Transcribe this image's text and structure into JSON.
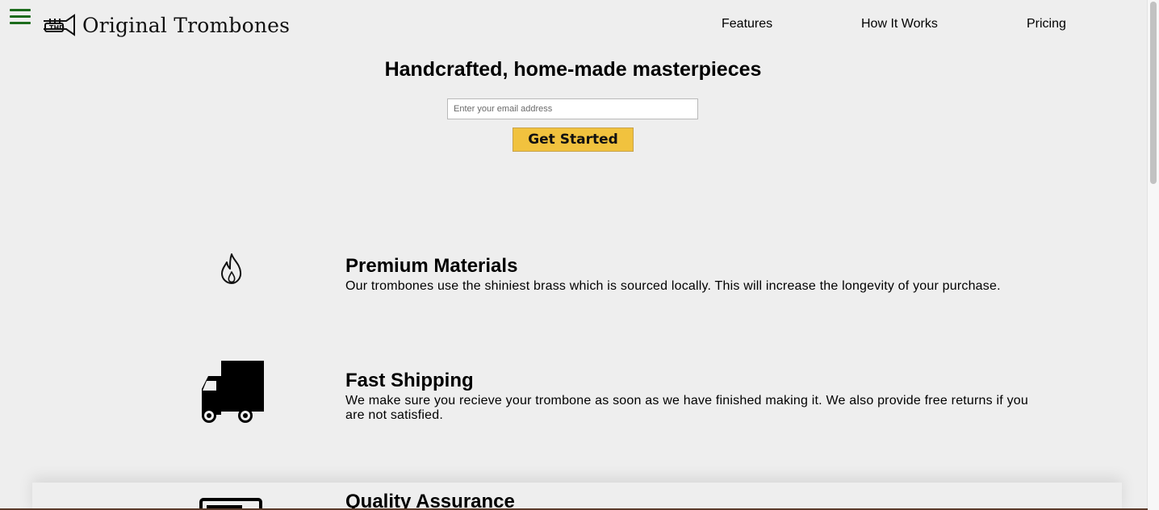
{
  "header": {
    "brand": "Original Trombones",
    "nav": [
      {
        "label": "Features"
      },
      {
        "label": "How It Works"
      },
      {
        "label": "Pricing"
      }
    ]
  },
  "hero": {
    "title": "Handcrafted, home-made masterpieces",
    "email_placeholder": "Enter your email address",
    "email_value": "",
    "cta_label": "Get Started"
  },
  "features": [
    {
      "icon": "fire-icon",
      "title": "Premium Materials",
      "description": "Our trombones use the shiniest brass which is sourced locally. This will increase the longevity of your purchase."
    },
    {
      "icon": "truck-icon",
      "title": "Fast Shipping",
      "description": "We make sure you recieve your trombone as soon as we have finished making it. We also provide free returns if you are not satisfied."
    },
    {
      "icon": "certificate-icon",
      "title": "Quality Assurance"
    }
  ],
  "colors": {
    "background": "#eeeeee",
    "menu_icon": "#1c6b1c",
    "cta_button": "#f1c23e"
  }
}
